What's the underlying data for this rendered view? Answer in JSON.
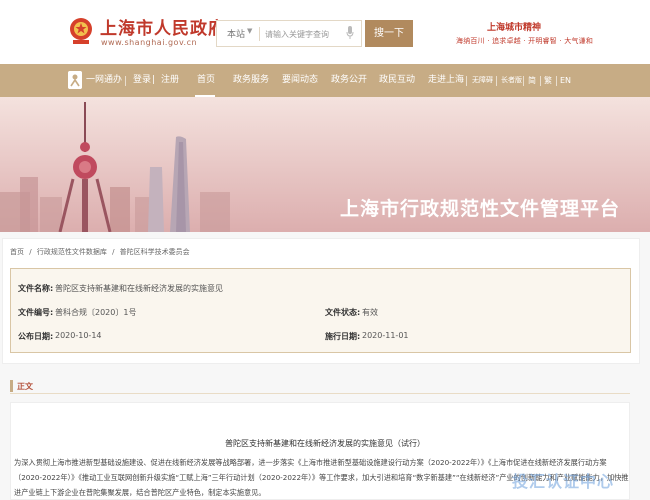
{
  "header": {
    "site_name": "上海市人民政府",
    "site_url": "www.shanghai.gov.cn",
    "search": {
      "scope": "本站",
      "placeholder": "请输入关键字查询",
      "button_label": "搜一下"
    },
    "spirit": {
      "title": "上海城市精神",
      "motto": "海纳百川 · 追求卓越 · 开明睿智 · 大气谦和"
    }
  },
  "nav": {
    "yiwangtong": "一网通办",
    "login": "登录",
    "register": "注册",
    "items": [
      "首页",
      "政务服务",
      "要闻动态",
      "政务公开",
      "政民互动",
      "走进上海"
    ],
    "accessibility": "无障碍",
    "elderly": "长者版",
    "simplified": "简",
    "traditional": "繁",
    "english": "EN"
  },
  "banner": {
    "title": "上海市行政规范性文件管理平台"
  },
  "breadcrumb": [
    "首页",
    "/",
    "行政规范性文件数据库",
    "/",
    "普陀区科学技术委员会"
  ],
  "document_meta": {
    "name_label": "文件名称:",
    "name_value": "普陀区支持新基建和在线新经济发展的实施意见",
    "number_label": "文件编号:",
    "number_value": "普科合规〔2020〕1号",
    "status_label": "文件状态:",
    "status_value": "有效",
    "publish_label": "公布日期:",
    "publish_value": "2020-10-14",
    "effective_label": "施行日期:",
    "effective_value": "2020-11-01"
  },
  "body": {
    "section_title": "正文",
    "doc_title": "普陀区支持新基建和在线新经济发展的实施意见（试行）",
    "paragraph": "为深入贯彻上海市推进新型基础设施建设、促进在线新经济发展等战略部署，进一步落实《上海市推进新型基础设施建设行动方案（2020-2022年）》《上海市促进在线新经济发展行动方案（2020-2022年）》《推动工业互联网创新升级实施“工赋上海”三年行动计划（2020-2022年）》等工作要求，加大引进和培育“数字新基建”“在线新经济”产业的创新能力和产业赋能能力，加快推进产业链上下游企业在普陀集聚发展，结合普陀区产业特色，制定本实施意见。"
  },
  "watermark": "投汇认证中心",
  "colors": {
    "brand_red": "#c0392b",
    "nav_gold": "#c7ac85",
    "button_gold": "#b18a5e",
    "banner_pink": "#e8c8c5"
  }
}
